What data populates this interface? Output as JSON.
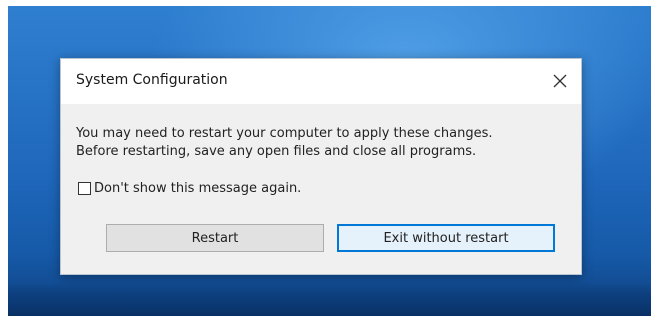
{
  "dialog": {
    "title": "System Configuration",
    "close_icon": "close-icon",
    "message_line1": "You may need to restart your computer to apply these changes.",
    "message_line2": "Before restarting, save any open files and close all programs.",
    "checkbox_label": "Don't show this message again.",
    "checkbox_checked": false,
    "restart_label": "Restart",
    "exit_label": "Exit without restart"
  },
  "colors": {
    "desktop_blue": "#1f67bb",
    "accent": "#0078d7",
    "dialog_bg": "#f0f0f0"
  }
}
